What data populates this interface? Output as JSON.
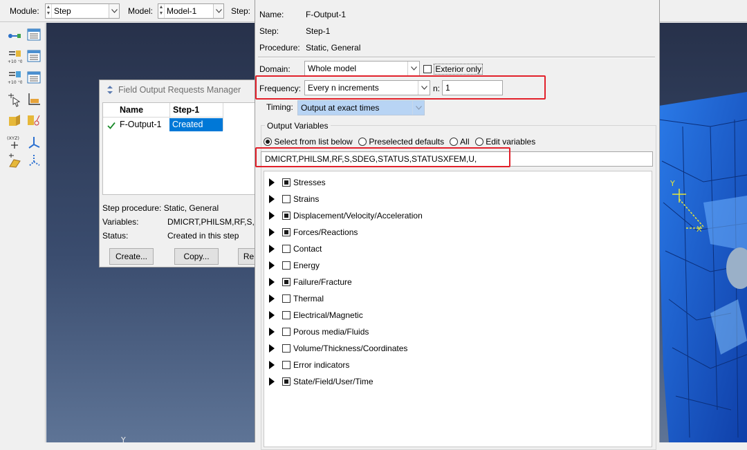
{
  "toolbar": {
    "module_label": "Module:",
    "module_value": "Step",
    "model_label": "Model:",
    "model_value": "Model-1",
    "step_label": "Step:"
  },
  "manager": {
    "title": "Field Output Requests Manager",
    "col_name": "Name",
    "col_step": "Step-1",
    "row_name": "F-Output-1",
    "row_status": "Created",
    "step_procedure_label": "Step procedure:",
    "step_procedure_value": "Static, General",
    "variables_label": "Variables:",
    "variables_value": "DMICRT,PHILSM,RF,S,S",
    "status_label": "Status:",
    "status_value": "Created in this step",
    "btn_create": "Create...",
    "btn_copy": "Copy...",
    "btn_partial": "Re"
  },
  "edit": {
    "name_label": "Name:",
    "name_value": "F-Output-1",
    "step_label": "Step:",
    "step_value": "Step-1",
    "procedure_label": "Procedure:",
    "procedure_value": "Static, General",
    "domain_label": "Domain:",
    "domain_value": "Whole model",
    "exterior_only": "Exterior only",
    "frequency_label": "Frequency:",
    "frequency_value": "Every n increments",
    "n_label": "n:",
    "n_value": "1",
    "timing_label": "Timing:",
    "timing_value": "Output at exact times",
    "output_variables_title": "Output Variables",
    "radio_select": "Select from list below",
    "radio_preselected": "Preselected defaults",
    "radio_all": "All",
    "radio_edit": "Edit variables",
    "variables_text": "DMICRT,PHILSM,RF,S,SDEG,STATUS,STATUSXFEM,U,",
    "tree": [
      {
        "label": "Stresses",
        "partial": true
      },
      {
        "label": "Strains",
        "partial": false
      },
      {
        "label": "Displacement/Velocity/Acceleration",
        "partial": true
      },
      {
        "label": "Forces/Reactions",
        "partial": true
      },
      {
        "label": "Contact",
        "partial": false
      },
      {
        "label": "Energy",
        "partial": false
      },
      {
        "label": "Failure/Fracture",
        "partial": true
      },
      {
        "label": "Thermal",
        "partial": false
      },
      {
        "label": "Electrical/Magnetic",
        "partial": false
      },
      {
        "label": "Porous media/Fluids",
        "partial": false
      },
      {
        "label": "Volume/Thickness/Coordinates",
        "partial": false
      },
      {
        "label": "Error indicators",
        "partial": false
      },
      {
        "label": "State/Field/User/Time",
        "partial": true
      }
    ]
  },
  "viewport": {
    "triad_y": "Y",
    "triad_x": "X",
    "bottom_axis": "Y"
  },
  "colors": {
    "selection": "#0078d7",
    "highlight_red": "#e2202a",
    "mesh_blue": "#1a5fd0"
  }
}
